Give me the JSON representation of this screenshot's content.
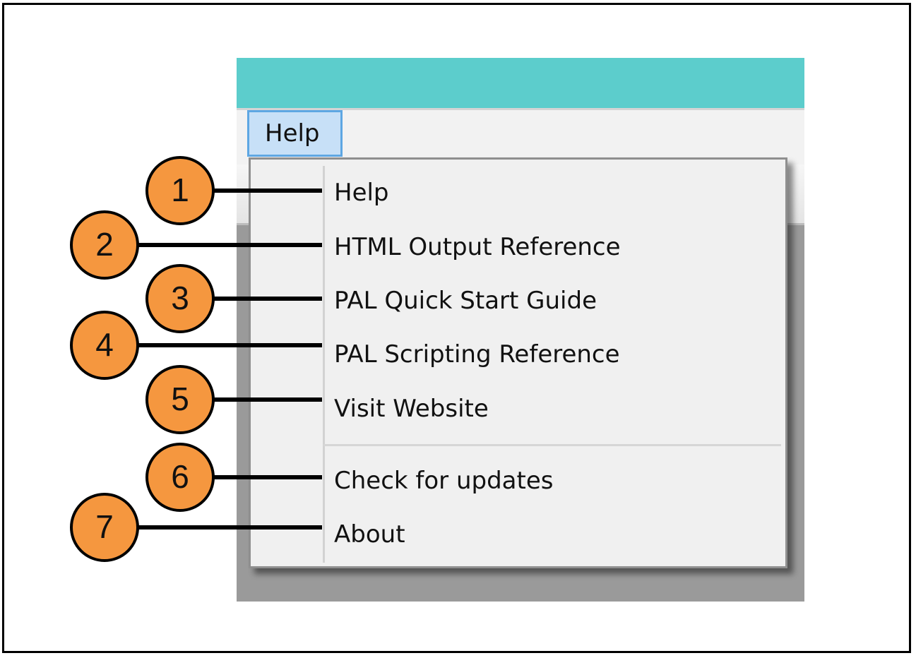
{
  "menu_bar": {
    "help_label": "Help"
  },
  "help_menu": {
    "items": [
      {
        "label": "Help"
      },
      {
        "label": "HTML Output Reference"
      },
      {
        "label": "PAL Quick Start Guide"
      },
      {
        "label": "PAL Scripting Reference"
      },
      {
        "label": "Visit Website"
      },
      {
        "label": "Check for updates"
      },
      {
        "label": "About"
      }
    ]
  },
  "callouts": [
    {
      "number": "1"
    },
    {
      "number": "2"
    },
    {
      "number": "3"
    },
    {
      "number": "4"
    },
    {
      "number": "5"
    },
    {
      "number": "6"
    },
    {
      "number": "7"
    }
  ],
  "colors": {
    "title_bar": "#5ccdcc",
    "menu_highlight": "#c7e0f7",
    "menu_highlight_border": "#5ea7e3",
    "callout_fill": "#f5973f",
    "callout_stroke": "#000000"
  }
}
